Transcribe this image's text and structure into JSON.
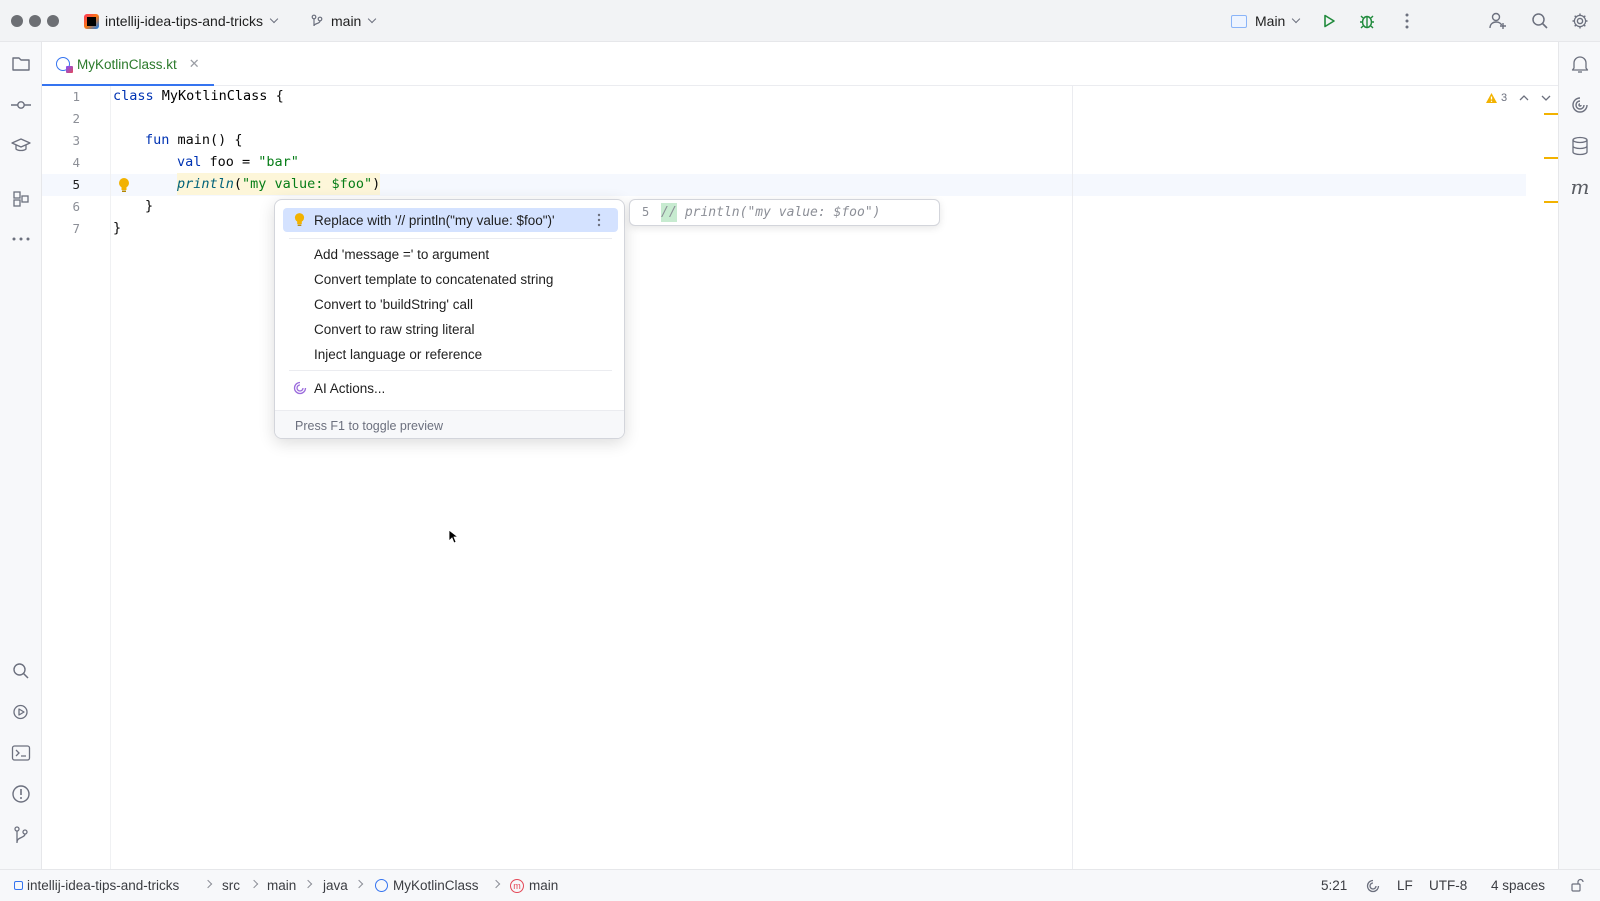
{
  "titlebar": {
    "project_name": "intellij-idea-tips-and-tricks",
    "branch": "main",
    "run_config": "Main"
  },
  "tab": {
    "file_name": "MyKotlinClass.kt"
  },
  "editor": {
    "line_numbers": [
      "1",
      "2",
      "3",
      "4",
      "5",
      "6",
      "7"
    ],
    "warnings_count": "3",
    "code": {
      "l1_kw": "class",
      "l1_name": " MyKotlinClass",
      "l1_brace": " {",
      "l3_kw": "fun",
      "l3_rest": " main() {",
      "l4_kw": "val",
      "l4_name": " foo = ",
      "l4_str": "\"bar\"",
      "l5_fn": "println",
      "l5_open": "(",
      "l5_str": "\"my value: $foo\"",
      "l5_close": ")",
      "l6": "}",
      "l7": "}"
    }
  },
  "popup": {
    "items": [
      "Replace with '// println(\"my value: $foo\")'",
      "Add 'message =' to argument",
      "Convert template to concatenated string",
      "Convert to 'buildString' call",
      "Convert to raw string literal",
      "Inject language or reference",
      "AI Actions..."
    ],
    "footer": "Press F1 to toggle preview"
  },
  "preview": {
    "line_number": "5",
    "comment": "//",
    "code": " println(\"my value: $foo\")"
  },
  "statusbar": {
    "breadcrumbs": [
      "intellij-idea-tips-and-tricks",
      "src",
      "main",
      "java",
      "MyKotlinClass",
      "main"
    ],
    "position": "5:21",
    "line_ending": "LF",
    "encoding": "UTF-8",
    "indent": "4 spaces"
  },
  "colors": {
    "accent": "#3574f0",
    "selection": "#d4e2ff",
    "warning": "#f2b200",
    "string": "#067d17",
    "keyword": "#0033b3"
  }
}
